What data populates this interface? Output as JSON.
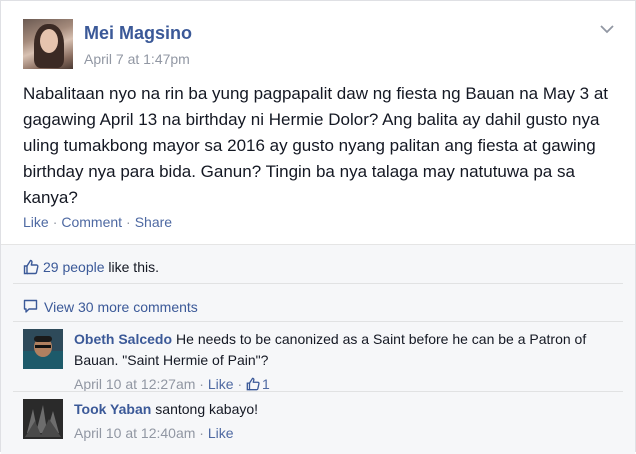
{
  "post": {
    "author": "Mei Magsino",
    "timestamp": "April 7 at 1:47pm",
    "text": "Nabalitaan nyo na rin ba yung pagpapalit daw ng fiesta ng Bauan na May 3 at gagawing April 13 na birthday ni Hermie Dolor? Ang balita ay dahil gusto nya uling tumakbong mayor sa 2016 ay gusto nyang palitan ang fiesta at gawing birthday nya para bida. Ganun? Tingin ba nya talaga may natutuwa pa sa kanya?",
    "actions": {
      "like": "Like",
      "comment": "Comment",
      "share": "Share",
      "separator": "·"
    }
  },
  "likes": {
    "count_text": "29 people",
    "suffix": " like this."
  },
  "view_more": "View 30 more comments",
  "comments": [
    {
      "author": "Obeth Salcedo",
      "text": "He needs to be canonized as a Saint before he can be a Patron of Bauan. \"Saint Hermie of Pain\"?",
      "timestamp": "April 10 at 12:27am",
      "like_label": "Like",
      "like_count": "1"
    },
    {
      "author": "Took Yaban",
      "text": "santong kabayo!",
      "timestamp": "April 10 at 12:40am",
      "like_label": "Like"
    }
  ],
  "icons": {
    "chevron": "chevron-down-icon",
    "thumbs_up": "thumbs-up-icon",
    "comment_bubble": "comment-bubble-icon"
  },
  "colors": {
    "link": "#3b5998",
    "meta": "#9197a3",
    "ufi_bg": "#f6f7f9"
  }
}
